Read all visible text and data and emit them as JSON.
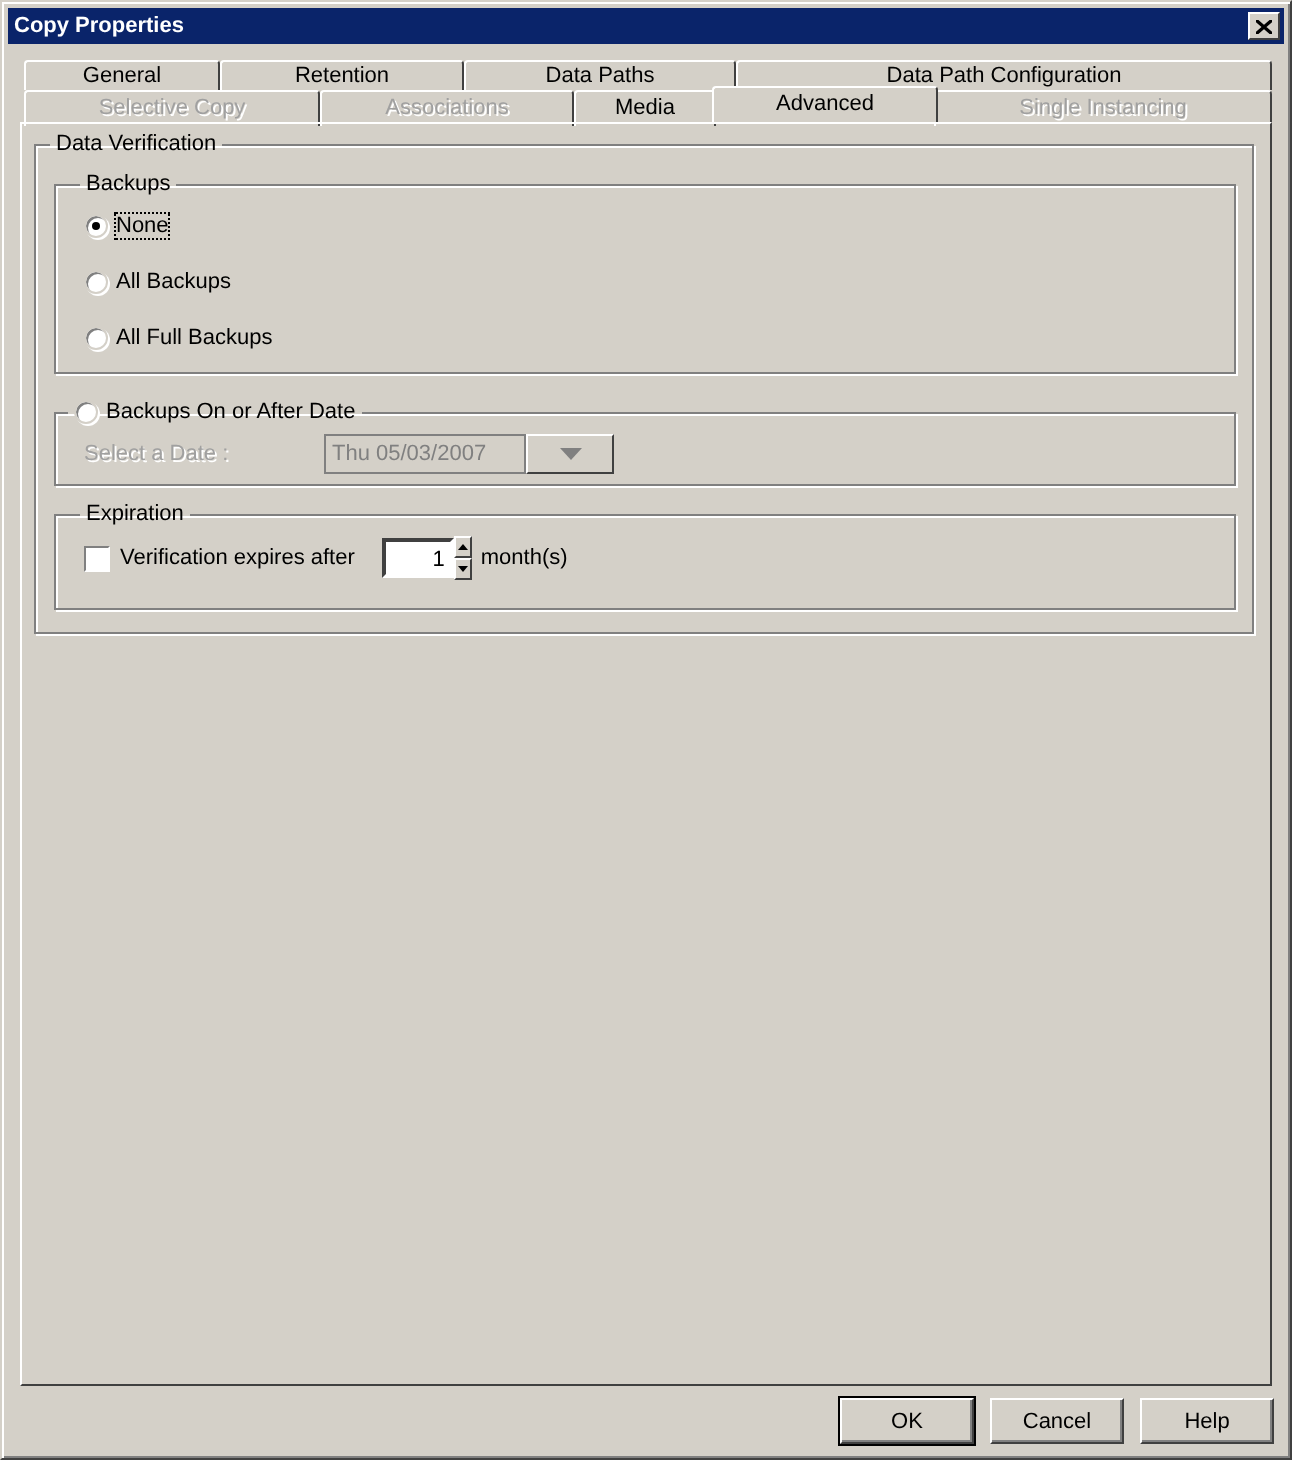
{
  "window": {
    "title": "Copy Properties"
  },
  "tab_rows": [
    {
      "tabs": [
        {
          "label": "General",
          "selected": false,
          "disabled": false
        },
        {
          "label": "Retention",
          "selected": false,
          "disabled": false
        },
        {
          "label": "Data Paths",
          "selected": false,
          "disabled": false
        },
        {
          "label": "Data Path Configuration",
          "selected": false,
          "disabled": false
        }
      ]
    },
    {
      "tabs": [
        {
          "label": "Selective Copy",
          "selected": false,
          "disabled": true
        },
        {
          "label": "Associations",
          "selected": false,
          "disabled": true
        },
        {
          "label": "Media",
          "selected": false,
          "disabled": false
        },
        {
          "label": "Advanced",
          "selected": true,
          "disabled": false
        },
        {
          "label": "Single Instancing",
          "selected": false,
          "disabled": true
        }
      ]
    }
  ],
  "data_verification": {
    "title": "Data Verification",
    "backups": {
      "title": "Backups",
      "options": [
        {
          "label": "None",
          "selected": true,
          "focused": true
        },
        {
          "label": "All Backups",
          "selected": false,
          "focused": false
        },
        {
          "label": "All Full Backups",
          "selected": false,
          "focused": false
        }
      ]
    },
    "date_option": {
      "label": "Backups On or After Date",
      "selected": false,
      "disabled": true,
      "date_label": "Select a Date :",
      "date_value": "Thu 05/03/2007"
    },
    "expiration": {
      "title": "Expiration",
      "checkbox": {
        "label": "Verification expires after",
        "checked": false
      },
      "months": "1",
      "unit": "month(s)"
    }
  },
  "buttons": [
    {
      "label": "OK",
      "default": true
    },
    {
      "label": "Cancel",
      "default": false
    },
    {
      "label": "Help",
      "default": false
    }
  ]
}
